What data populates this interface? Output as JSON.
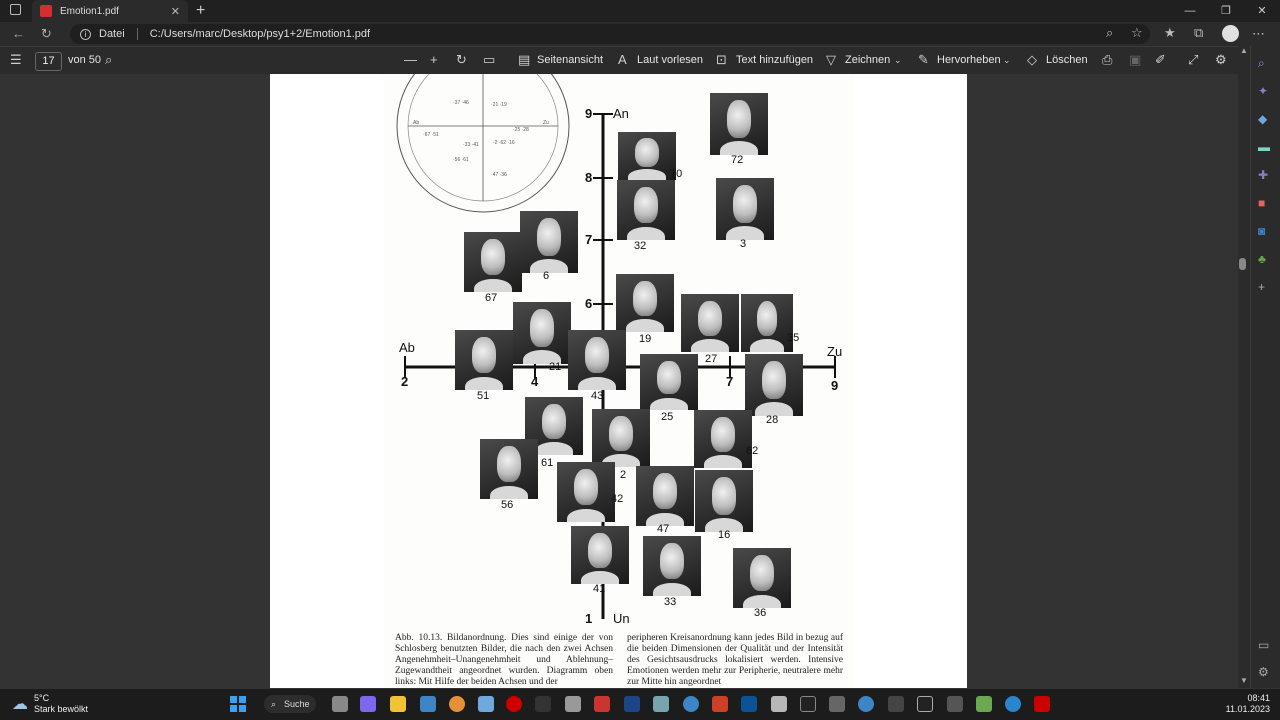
{
  "browser": {
    "tab_title": "Emotion1.pdf",
    "tab_close": "✕",
    "new_tab": "+",
    "scheme_label": "Datei",
    "url": "C:/Users/marc/Desktop/psy1+2/Emotion1.pdf"
  },
  "pdf_toolbar": {
    "page_current": "17",
    "page_total": "von 50",
    "page_view": "Seitenansicht",
    "read_aloud": "Laut vorlesen",
    "add_text": "Text hinzufügen",
    "draw": "Zeichnen",
    "highlight": "Hervorheben",
    "erase": "Löschen"
  },
  "figure": {
    "axis_top": "An",
    "axis_bottom": "Un",
    "axis_left": "Ab",
    "axis_right": "Zu",
    "ticks_y": [
      "9",
      "8",
      "7",
      "6",
      "1"
    ],
    "ticks_x": [
      "2",
      "4",
      "7",
      "9"
    ],
    "face_numbers": [
      "72",
      "70",
      "32",
      "3",
      "6",
      "67",
      "19",
      "27",
      "35",
      "21",
      "51",
      "43",
      "25",
      "28",
      "61",
      "2",
      "62",
      "56",
      "42",
      "47",
      "16",
      "41",
      "33",
      "36"
    ]
  },
  "caption": {
    "left": "Abb. 10.13. Bildanordnung. Dies sind einige der von Schlosberg benutzten Bilder, die nach den zwei Achsen Angenehmheit–Unangenehmheit und Ablehnung–Zugewandtheit angeordnet wurden. Diagramm oben links: Mit Hilfe der beiden Achsen und der",
    "right": "peripheren Kreisanordnung kann jedes Bild in bezug auf die beiden Dimensionen der Qualität und der Intensität des Gesichtsausdrucks lokalisiert werden. Intensive Emotionen werden mehr zur Peripherie, neutralere mehr zur Mitte hin angeordnet"
  },
  "taskbar": {
    "weather_temp": "5°C",
    "weather_desc": "Stark bewölkt",
    "search_label": "Suche",
    "time": "08:41",
    "date": "11.01.2023"
  }
}
